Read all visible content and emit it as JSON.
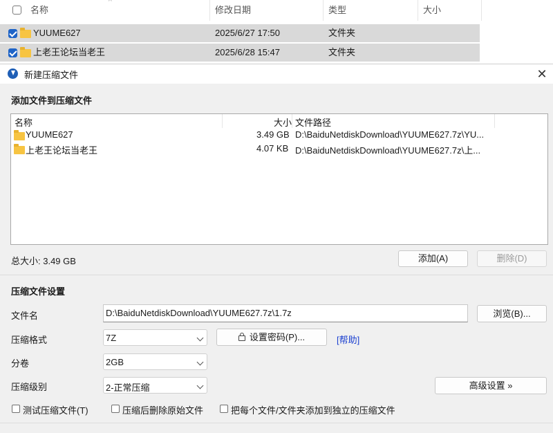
{
  "explorer": {
    "columns": {
      "name": "名称",
      "modified": "修改日期",
      "type": "类型",
      "size": "大小"
    },
    "rows": [
      {
        "name": "YUUME627",
        "modified": "2025/6/27 17:50",
        "type": "文件夹"
      },
      {
        "name": "上老王论坛当老王",
        "modified": "2025/6/28 15:47",
        "type": "文件夹"
      }
    ]
  },
  "dialog": {
    "title": "新建压缩文件",
    "close_glyph": "✕",
    "add_section": "添加文件到压缩文件",
    "list": {
      "columns": {
        "name": "名称",
        "size": "大小",
        "path": "文件路径"
      },
      "rows": [
        {
          "name": "YUUME627",
          "size": "3.49 GB",
          "path": "D:\\BaiduNetdiskDownload\\YUUME627.7z\\YU..."
        },
        {
          "name": "上老王论坛当老王",
          "size": "4.07 KB",
          "path": "D:\\BaiduNetdiskDownload\\YUUME627.7z\\上..."
        }
      ]
    },
    "total_size": "总大小: 3.49 GB",
    "add_button": "添加(A)",
    "delete_button": "删除(D)",
    "settings_section": "压缩文件设置",
    "filename_label": "文件名",
    "filename_value": "D:\\BaiduNetdiskDownload\\YUUME627.7z\\1.7z",
    "browse_button": "浏览(B)...",
    "format_label": "压缩格式",
    "format_value": "7Z",
    "password_button": "设置密码(P)...",
    "help_link": "[帮助]",
    "split_label": "分卷",
    "split_value": "2GB",
    "level_label": "压缩级别",
    "level_value": "2-正常压缩",
    "advanced_button": "高级设置 »",
    "options": {
      "test": "测试压缩文件(T)",
      "delete_after": "压缩后删除原始文件",
      "each_separate": "把每个文件/文件夹添加到独立的压缩文件"
    }
  },
  "icons": {
    "folder": "folder-icon",
    "app": "app-logo-icon",
    "lock": "lock-icon"
  },
  "colors": {
    "checkbox_accent": "#1f64c7",
    "selection": "#d9d9d9",
    "folder": "#f7c442",
    "link": "#1a3fd0"
  }
}
